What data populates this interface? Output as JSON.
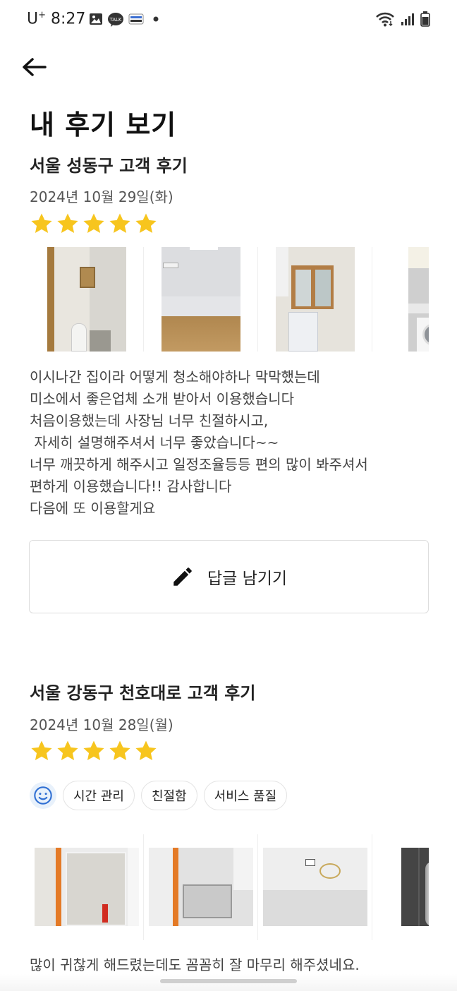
{
  "status_bar": {
    "carrier": "U",
    "carrier_sup": "+",
    "time": "8:27"
  },
  "header": {
    "title": "내 후기 보기"
  },
  "reviews": [
    {
      "title": "서울 성동구 고객 후기",
      "date": "2024년 10월 29일(화)",
      "rating": 5,
      "body": [
        "이시나간 집이라 어떻게 청소해야하나 막막했는데",
        "미소에서 좋은업체 소개 받아서 이용했습니다",
        "처음이용했는데 사장님 너무 친절하시고,",
        " 자세히 설명해주셔서 너무 좋았습니다~~",
        "너무 깨끗하게 해주시고 일정조율등등 편의 많이 봐주셔서",
        "편하게 이용했습니다!! 감사합니다",
        "다음에 또 이용할게요"
      ],
      "reply_label": "답글 남기기"
    },
    {
      "title": "서울 강동구 천호대로 고객 후기",
      "date": "2024년 10월 28일(월)",
      "rating": 5,
      "tags": [
        "시간 관리",
        "친절함",
        "서비스 품질"
      ],
      "body": [
        "많이 귀찮게 해드렸는데도 꼼꼼히 잘 마무리 해주셨네요."
      ]
    }
  ],
  "colors": {
    "star": "#F7C51E",
    "text_primary": "#111111",
    "text_secondary": "#555555",
    "border": "#DDDDDD"
  }
}
